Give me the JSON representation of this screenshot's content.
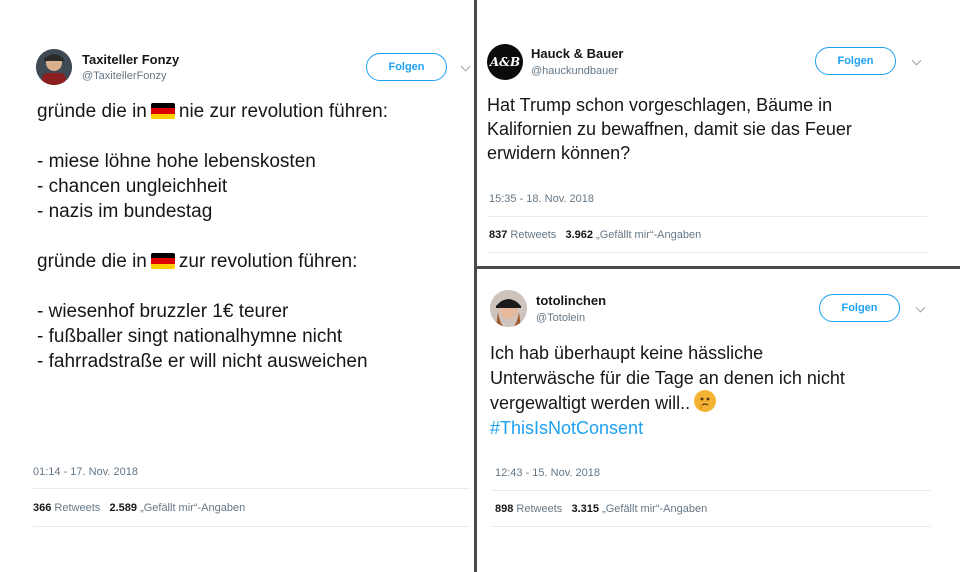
{
  "tweets": [
    {
      "name": "Taxiteller Fonzy",
      "handle": "@TaxitellerFonzy",
      "follow_label": "Folgen",
      "lines": [
        "gründe die in",
        "nie zur revolution führen:",
        "- miese löhne hohe lebenskosten",
        "- chancen ungleichheit",
        "- nazis im bundestag",
        "gründe die in",
        "zur revolution führen:",
        "- wiesenhof bruzzler 1€ teurer",
        "- fußballer singt nationalhymne nicht",
        "- fahrradstraße er will nicht ausweichen"
      ],
      "flag_icon": "german-flag-icon",
      "timestamp": "01:14 - 17. Nov. 2018",
      "retweets": "366",
      "retweets_label": "Retweets",
      "likes": "2.589",
      "likes_label": "„Gefällt mir“-Angaben"
    },
    {
      "name": "Hauck & Bauer",
      "handle": "@hauckundbauer",
      "avatar_text": "A&B",
      "follow_label": "Folgen",
      "lines": [
        "Hat Trump schon vorgeschlagen, Bäume in",
        "Kalifornien zu bewaffnen, damit sie das Feuer",
        "erwidern können?"
      ],
      "timestamp": "15:35 - 18. Nov. 2018",
      "retweets": "837",
      "retweets_label": "Retweets",
      "likes": "3.962",
      "likes_label": "„Gefällt mir“-Angaben"
    },
    {
      "name": "totolinchen",
      "handle": "@Totolein",
      "follow_label": "Folgen",
      "lines": [
        "Ich hab überhaupt keine hässliche",
        "Unterwäsche für die Tage an denen ich nicht",
        "vergewaltigt werden will.."
      ],
      "emoji_icon": "thinking-face-icon",
      "hashtag": "#ThisIsNotConsent",
      "timestamp": "12:43 - 15. Nov. 2018",
      "retweets": "898",
      "retweets_label": "Retweets",
      "likes": "3.315",
      "likes_label": "„Gefällt mir“-Angaben"
    }
  ],
  "colors": {
    "accent": "#1da1f2",
    "divider": "#4b4b4b",
    "secondary_text": "#657786",
    "flag": [
      "#000000",
      "#dd0000",
      "#ffce00"
    ]
  }
}
